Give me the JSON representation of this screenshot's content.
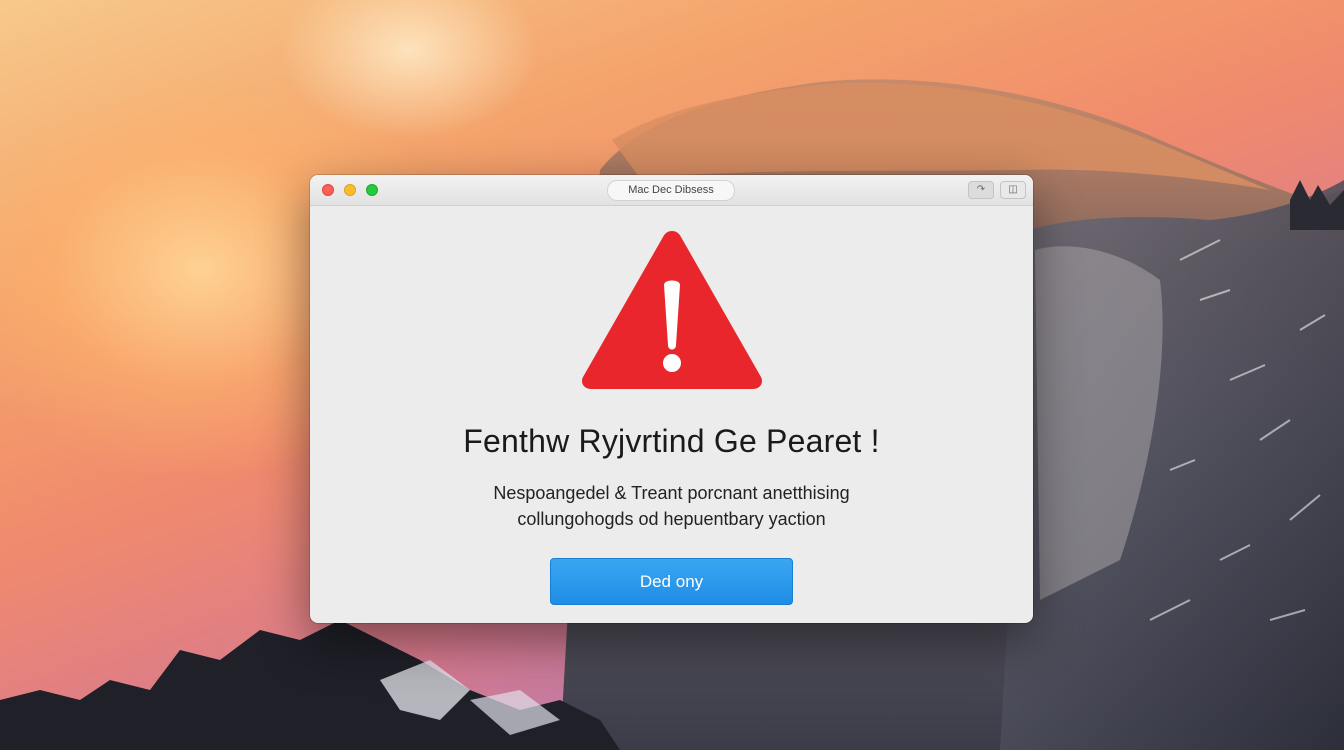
{
  "colors": {
    "alert_red": "#e8262b",
    "button_blue": "#2b99ec",
    "window_bg": "#ececec"
  },
  "window": {
    "title": "Mac Dec Dibsess",
    "toolbar_icons": [
      "share-icon",
      "sidebar-icon"
    ]
  },
  "dialog": {
    "icon": "warning-triangle-icon",
    "heading": "Fenthw Ryjvrtind Ge Pearet !",
    "message_line1": "Nespoangedel & Treant porcnant anetthising",
    "message_line2": "collungohogds od hepuentbary yaction",
    "button_label": "Ded ony"
  }
}
